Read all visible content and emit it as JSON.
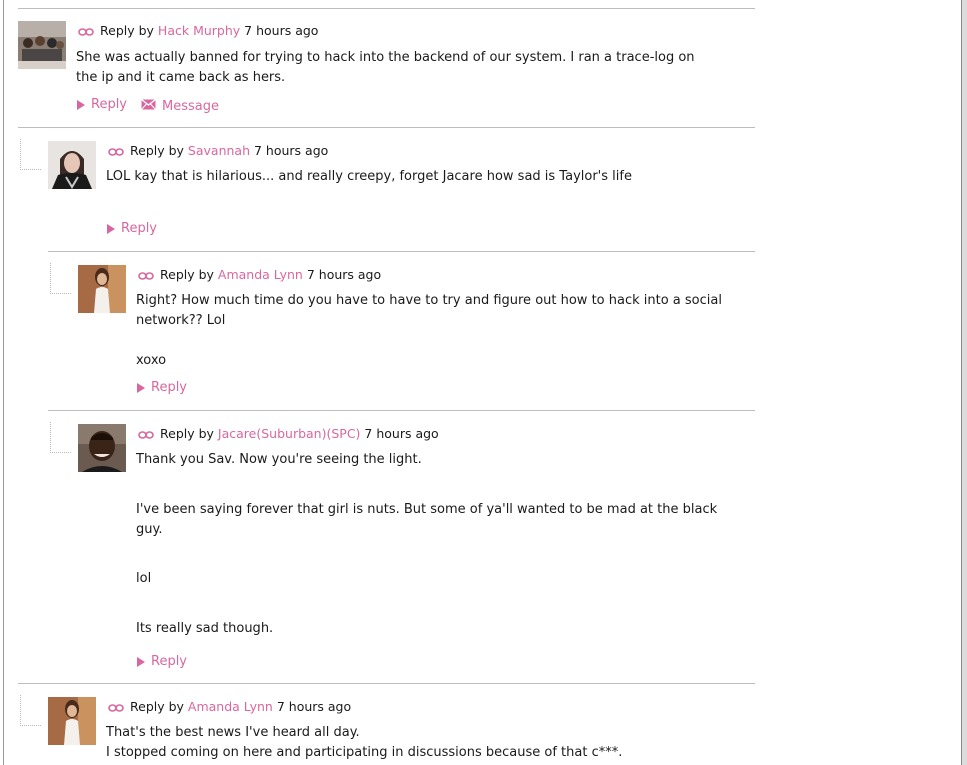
{
  "colors": {
    "accent": "#d9679f",
    "divider": "#bdbdbd"
  },
  "comments": [
    {
      "author": "Hack Murphy",
      "reply_by": "Reply by",
      "time": "7 hours ago",
      "paragraphs": [
        "She was actually banned for trying to hack into the backend of our system. I ran a trace-log on the ip and it came back as hers."
      ],
      "reply_label": "Reply",
      "message_label": "Message"
    },
    {
      "author": "Savannah",
      "reply_by": "Reply by",
      "time": "7 hours ago",
      "paragraphs": [
        "LOL kay that is hilarious... and really creepy, forget Jacare how sad is Taylor's life"
      ],
      "reply_label": "Reply"
    },
    {
      "author": "Amanda Lynn",
      "reply_by": "Reply by",
      "time": "7 hours ago",
      "paragraphs": [
        "Right? How much time do you have to have to try and figure out how to hack into a social network?? Lol",
        "xoxo"
      ],
      "reply_label": "Reply"
    },
    {
      "author": "Jacare(Suburban)(SPC)",
      "reply_by": "Reply by",
      "time": "7 hours ago",
      "paragraphs": [
        "Thank you Sav. Now you're seeing the light.",
        "I've been saying forever that girl is nuts. But some of ya'll wanted to be mad at the black guy.",
        "lol",
        "Its really sad though."
      ],
      "reply_label": "Reply"
    },
    {
      "author": "Amanda Lynn",
      "reply_by": "Reply by",
      "time": "7 hours ago",
      "paragraphs": [
        "That's the best news I've heard all day.",
        "I stopped coming on here and participating in discussions because of that c***."
      ]
    }
  ]
}
